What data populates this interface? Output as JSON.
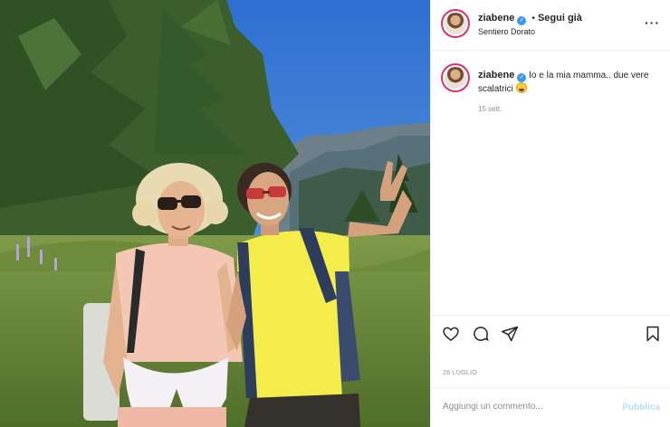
{
  "post": {
    "username": "ziabene",
    "verified_glyph": "✓",
    "separator": "•",
    "follow_label": "Segui già",
    "location": "Sentiero Dorato",
    "more_label": "···"
  },
  "caption": {
    "username": "ziabene",
    "text": "Io e la mia mamma.. due vere scalatrici",
    "emoji_icon": "laughing-emoji-icon",
    "date": "15 sett."
  },
  "actions": {
    "icons": [
      "heart-icon",
      "comment-icon",
      "share-icon",
      "bookmark-icon"
    ]
  },
  "post_date": "26 LUGLIO",
  "comment": {
    "placeholder": "Aggiungi un commento...",
    "publish_label": "Pubblica"
  },
  "colors": {
    "verified": "#3897f0",
    "publish_disabled": "#b2dffc",
    "sky": "#3f7fd6"
  }
}
